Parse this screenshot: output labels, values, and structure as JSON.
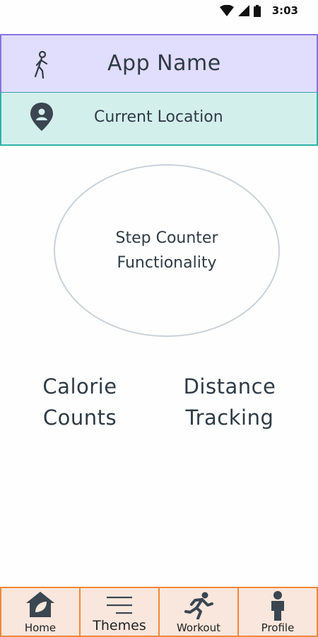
{
  "status_bar": {
    "time": "3:03",
    "icons": [
      "wifi-icon",
      "signal-icon",
      "battery-icon"
    ]
  },
  "header": {
    "title": "App Name",
    "icon": "walking-person-icon"
  },
  "location": {
    "label": "Current Location",
    "icon": "location-pin-icon"
  },
  "step_counter": {
    "label": "Step Counter\nFunctionality"
  },
  "features": {
    "calorie": "Calorie\nCounts",
    "distance": "Distance\nTracking"
  },
  "bottom_nav": {
    "items": [
      {
        "label": "Home",
        "icon": "home-leaf-icon"
      },
      {
        "label": "Themes",
        "icon": "menu-lines-icon"
      },
      {
        "label": "Workout",
        "icon": "runner-icon"
      },
      {
        "label": "Profile",
        "icon": "person-icon"
      }
    ]
  },
  "colors": {
    "header_bg": "#e0ddfd",
    "header_border": "#8a72e0",
    "location_bg": "#d3efec",
    "location_border": "#2fb3a6",
    "nav_bg": "#f9e6dc",
    "nav_border": "#f0883a",
    "text": "#2f3b46"
  }
}
